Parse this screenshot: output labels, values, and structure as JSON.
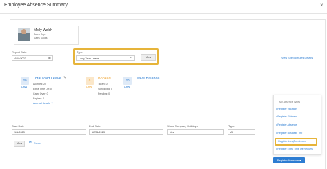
{
  "window": {
    "title": "Employee Absence Summary",
    "close_glyph": "×"
  },
  "employee": {
    "name": "Molly Welch",
    "role": "Sales Rep.",
    "location": "Sales Dallas"
  },
  "filters": {
    "report_date_label": "Report Date",
    "report_date_value": "4/19/2023",
    "type_label": "Type",
    "type_value": "Long Term Leave",
    "view_label": "View",
    "special_link": "View Special Rules Details"
  },
  "total_paid": {
    "badge": "20",
    "badge_caption": "Days",
    "title": "Total Paid Leave",
    "accrued": "Accrued: 20",
    "extra_time_off": "Extra Time Off: 0",
    "carry_over": "Carry Over: 0",
    "expired": "Expired: 0",
    "accrual_details": "Accrual details ▼"
  },
  "booked": {
    "badge": "0",
    "badge_caption": "Days",
    "title": "Booked",
    "taken": "Taken: 0",
    "scheduled": "Scheduled: 0",
    "pending": "Pending: 0"
  },
  "balance": {
    "badge": "20",
    "badge_caption": "Days",
    "title": "Leave Balance"
  },
  "range": {
    "start_label": "Start Date",
    "start_value": "1/1/2023",
    "end_label": "End Date",
    "end_value": "12/31/2023",
    "holidays_label": "Show Company Holidays",
    "holidays_value": "Yes",
    "type_label": "Type",
    "type_value": "All",
    "view_label": "View",
    "export_label": "Export"
  },
  "menu": {
    "header": "My Absence Types",
    "items": [
      "Register Vacation",
      "Register Sickness",
      "Register Absence",
      "Register Business Trip",
      "Register LongTermLeave",
      "Register Extra Time Off Request"
    ],
    "register_button": "Register Absence ▾"
  },
  "colors": {
    "accent": "#2d7dd2",
    "highlight": "#e6b43a",
    "booked": "#f0a93c",
    "badge_blue": "#dfeaf7",
    "badge_orange": "#fbe7c9"
  }
}
